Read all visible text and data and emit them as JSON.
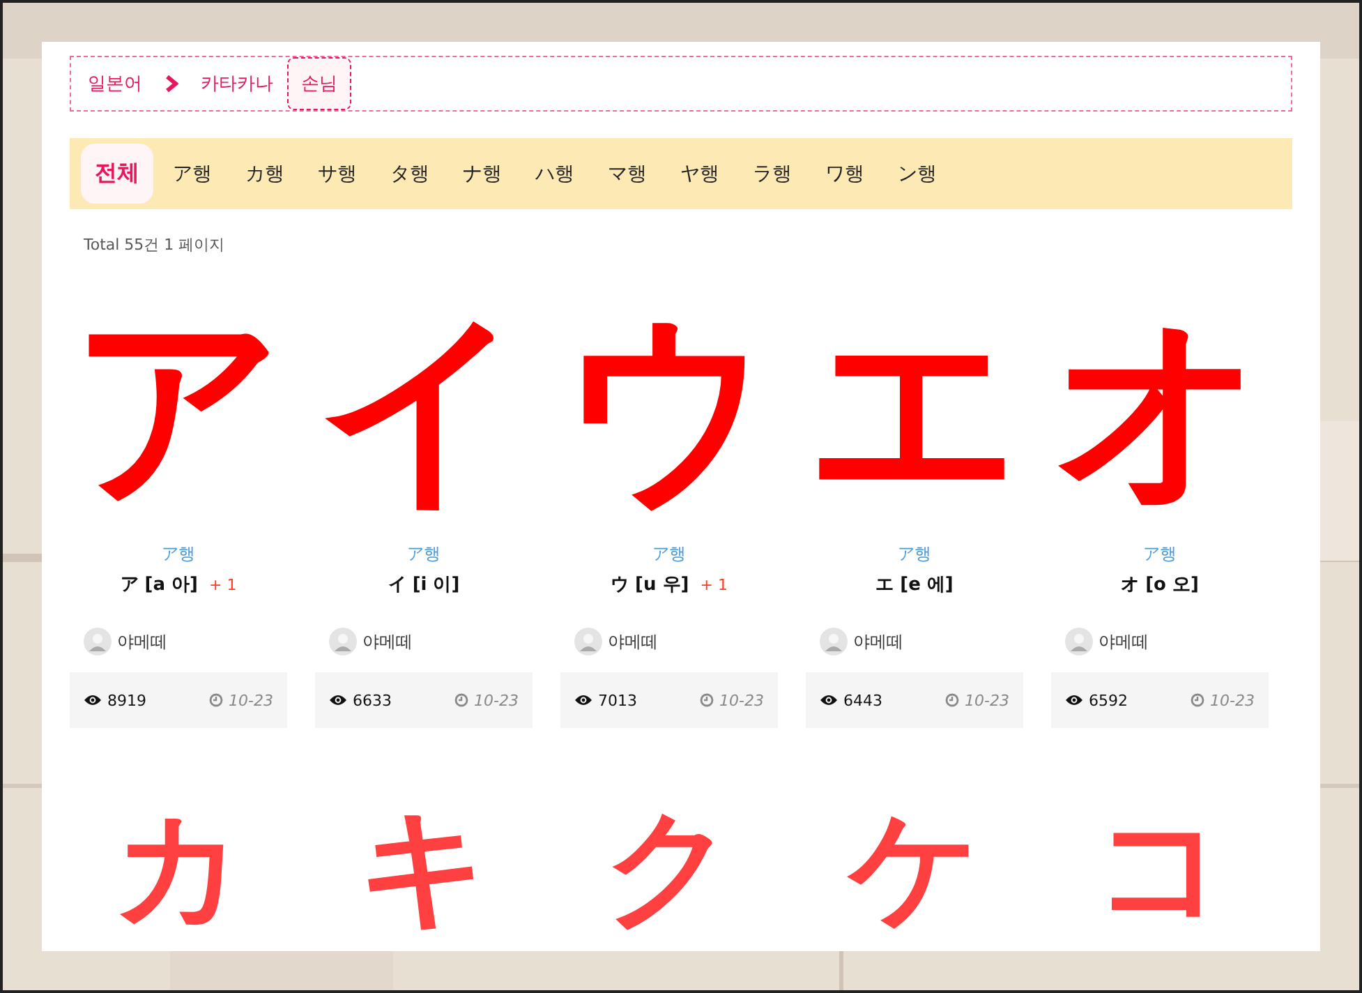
{
  "breadcrumb": [
    {
      "label": "일본어",
      "selected": false
    },
    {
      "label": "카타카나",
      "selected": false
    },
    {
      "label": "손님",
      "selected": true
    }
  ],
  "tabs": [
    {
      "label": "전체",
      "selected": true
    },
    {
      "label": "ア행",
      "selected": false
    },
    {
      "label": "カ행",
      "selected": false
    },
    {
      "label": "サ행",
      "selected": false
    },
    {
      "label": "タ행",
      "selected": false
    },
    {
      "label": "ナ행",
      "selected": false
    },
    {
      "label": "ハ행",
      "selected": false
    },
    {
      "label": "マ행",
      "selected": false
    },
    {
      "label": "ヤ행",
      "selected": false
    },
    {
      "label": "ラ행",
      "selected": false
    },
    {
      "label": "ワ행",
      "selected": false
    },
    {
      "label": "ン행",
      "selected": false
    }
  ],
  "total": "Total 55건 1 페이지",
  "cards": [
    {
      "glyph": "ア",
      "color": "#ff0000",
      "category": "ア행",
      "title": "ア [a 아]",
      "badge": "+ 1",
      "author": "야메떼",
      "views": "8919",
      "date": "10-23"
    },
    {
      "glyph": "イ",
      "color": "#ff0000",
      "category": "ア행",
      "title": "イ [i 이]",
      "author": "야메떼",
      "views": "6633",
      "date": "10-23"
    },
    {
      "glyph": "ウ",
      "color": "#ff0000",
      "category": "ア행",
      "title": "ウ [u 우]",
      "badge": "+ 1",
      "author": "야메떼",
      "views": "7013",
      "date": "10-23"
    },
    {
      "glyph": "エ",
      "color": "#ff0000",
      "category": "ア행",
      "title": "エ [e 에]",
      "author": "야메떼",
      "views": "6443",
      "date": "10-23"
    },
    {
      "glyph": "オ",
      "color": "#ff0000",
      "category": "ア행",
      "title": "オ [o 오]",
      "author": "야메떼",
      "views": "6592",
      "date": "10-23"
    },
    {
      "glyph": "カ",
      "color": "#ff4040"
    },
    {
      "glyph": "キ",
      "color": "#ff4040"
    },
    {
      "glyph": "ク",
      "color": "#ff4040"
    },
    {
      "glyph": "ケ",
      "color": "#ff4040"
    },
    {
      "glyph": "コ",
      "color": "#ff4040"
    }
  ]
}
